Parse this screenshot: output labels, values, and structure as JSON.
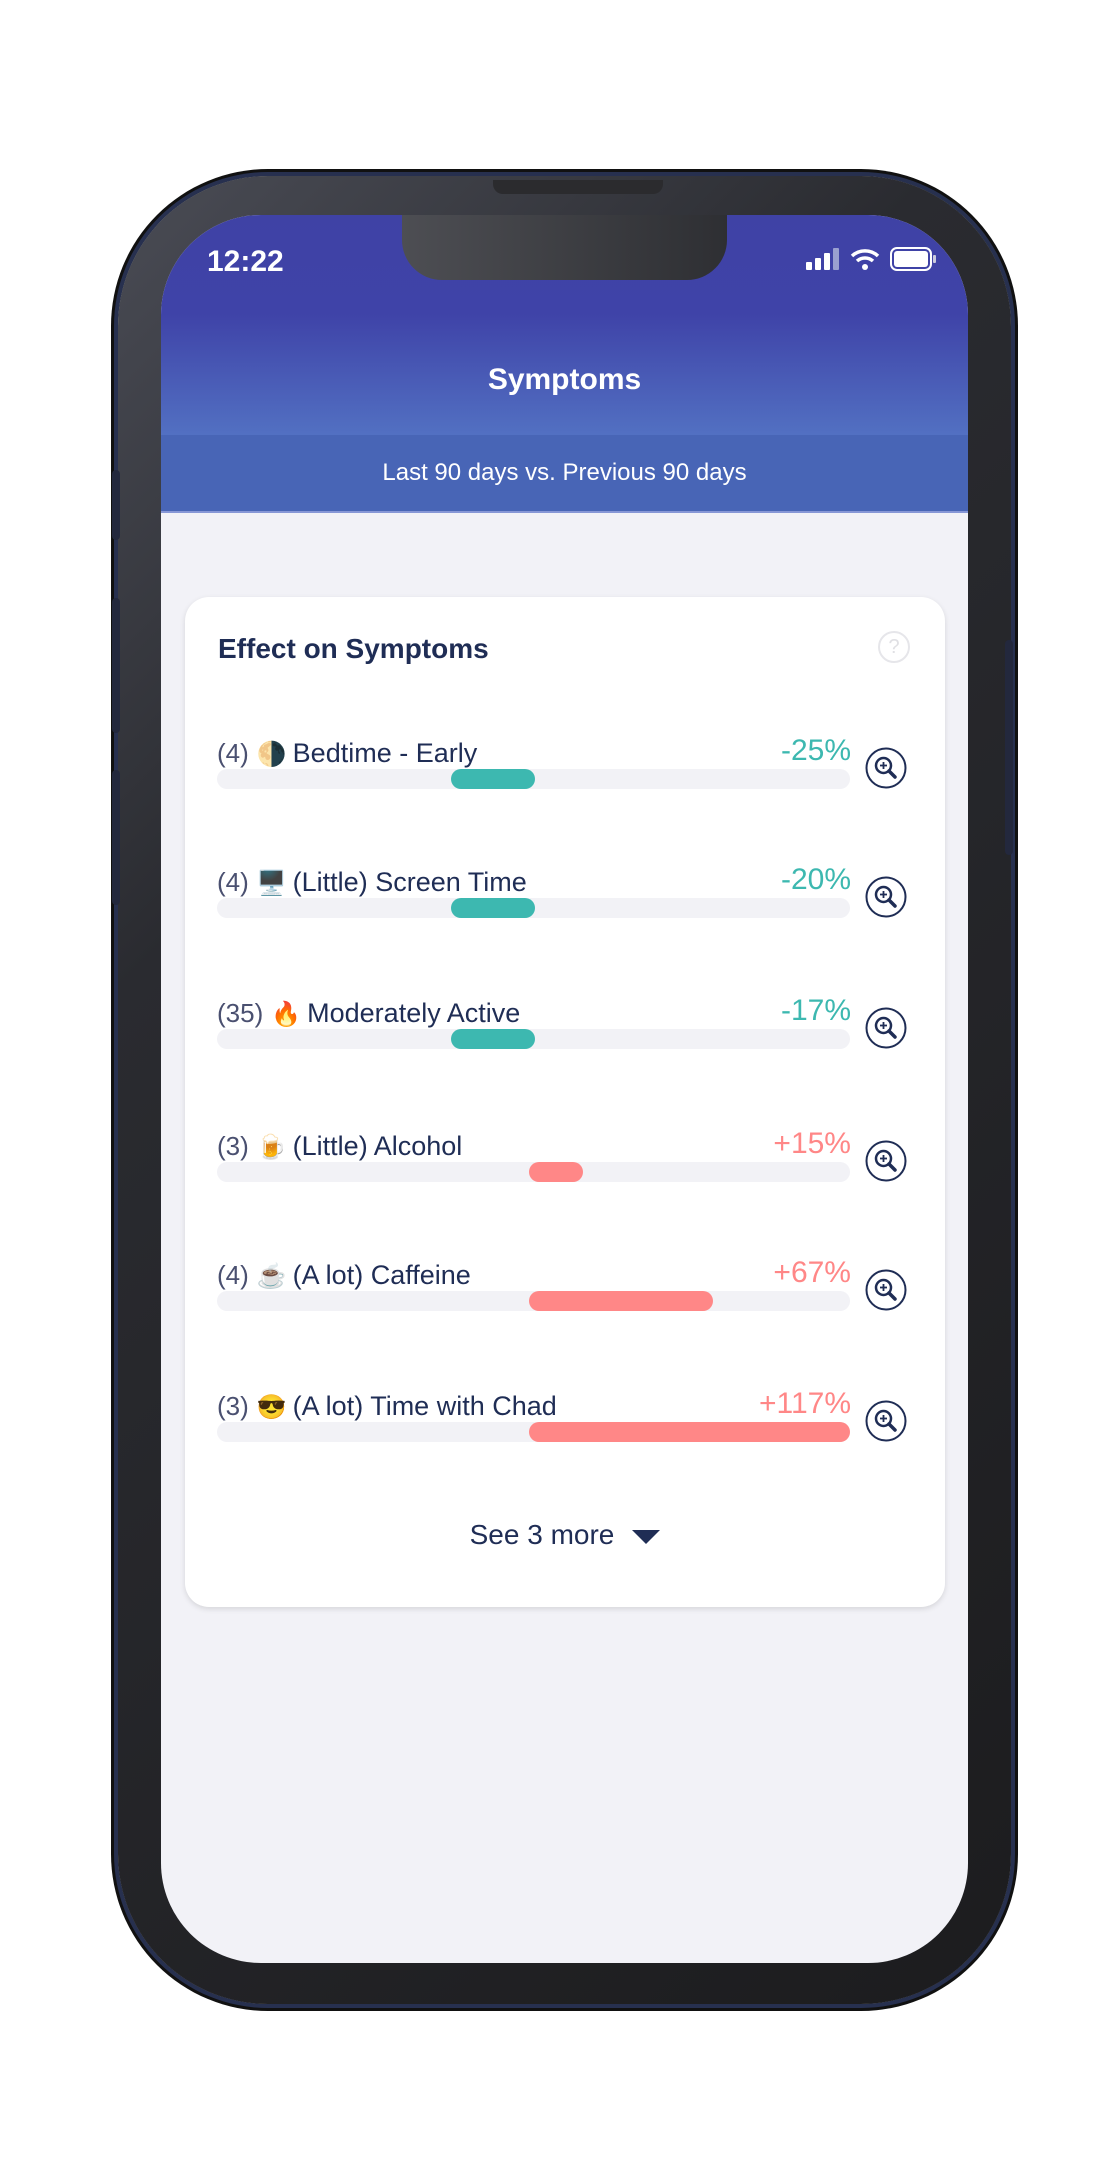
{
  "status_bar": {
    "time": "12:22"
  },
  "header": {
    "title": "Symptoms",
    "subtitle": "Last 90 days vs. Previous 90 days"
  },
  "card": {
    "title": "Effect on Symptoms",
    "help_icon": "question-circle-icon",
    "items": [
      {
        "count": "(4)",
        "emoji": "🌗",
        "label": "Bedtime - Early",
        "percent": "-25%",
        "value": -25
      },
      {
        "count": "(4)",
        "emoji": "🖥️",
        "label": "(Little) Screen Time",
        "percent": "-20%",
        "value": -20
      },
      {
        "count": "(35)",
        "emoji": "🔥",
        "label": "Moderately Active",
        "percent": "-17%",
        "value": -17
      },
      {
        "count": "(3)",
        "emoji": "🍺",
        "label": "(Little) Alcohol",
        "percent": "+15%",
        "value": 15
      },
      {
        "count": "(4)",
        "emoji": "☕",
        "label": "(A lot) Caffeine",
        "percent": "+67%",
        "value": 67
      },
      {
        "count": "(3)",
        "emoji": "😎",
        "label": "(A lot) Time with Chad",
        "percent": "+117%",
        "value": 117
      }
    ],
    "see_more": "See 3 more"
  },
  "colors": {
    "negative": "#3db8b0",
    "positive": "#ff8787",
    "header": "#3f42a5",
    "text": "#1f2d55"
  }
}
